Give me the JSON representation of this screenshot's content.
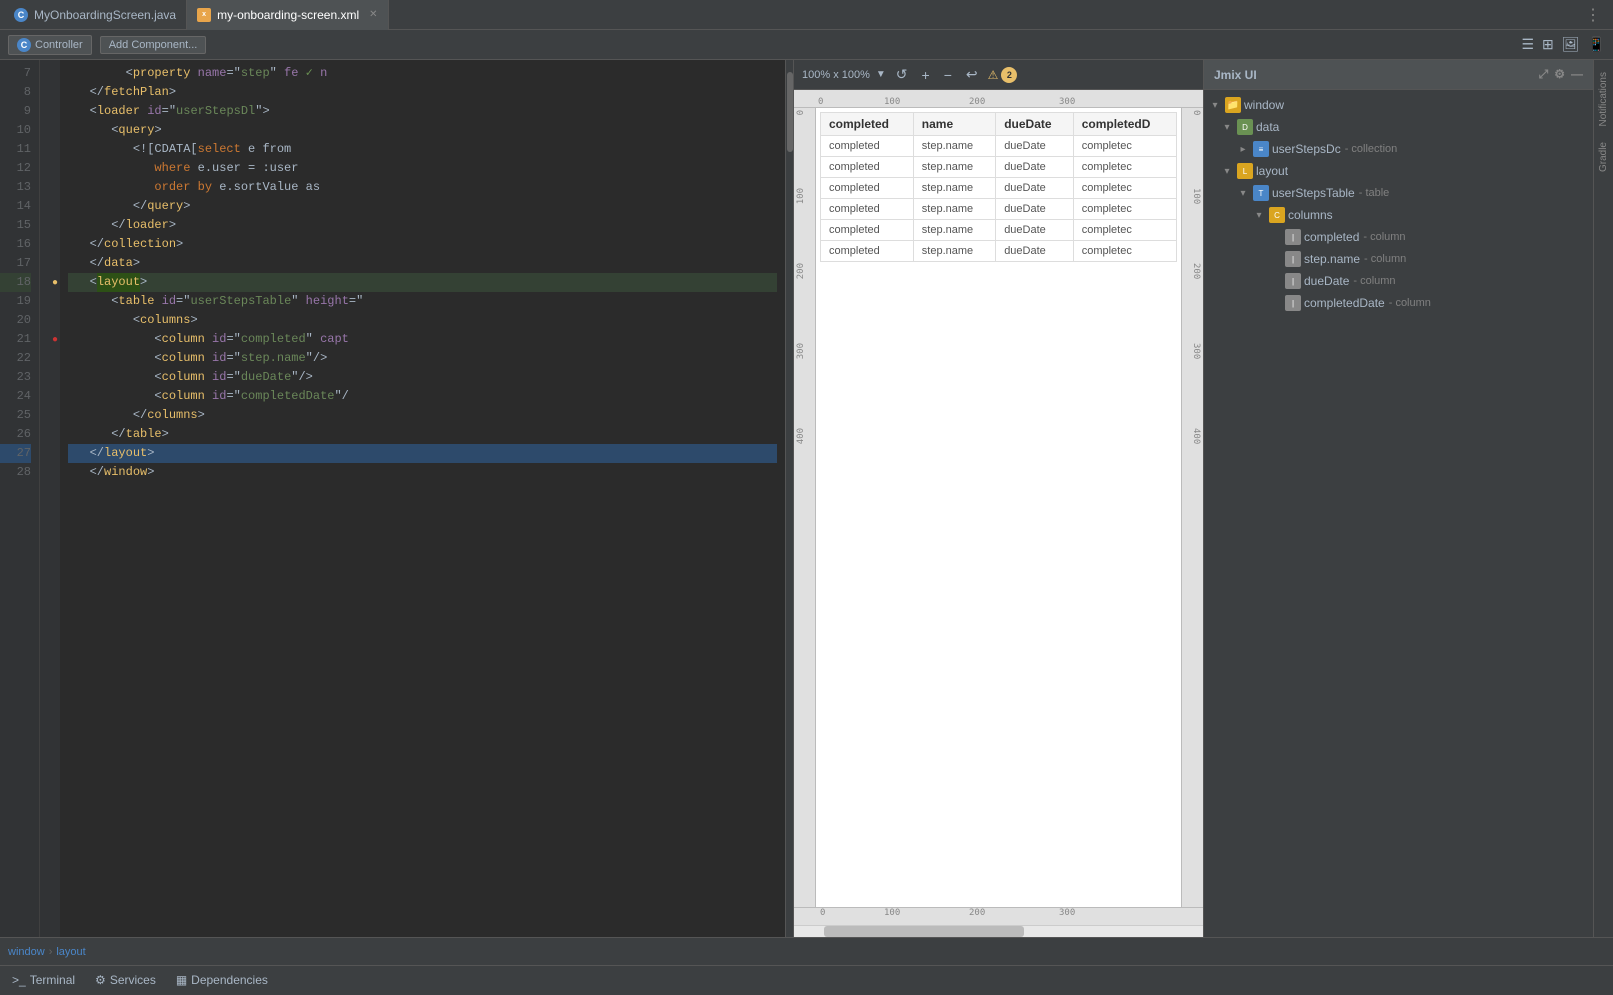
{
  "app": {
    "title": "Jmix UI"
  },
  "tabs": [
    {
      "id": "java",
      "label": "MyOnboardingScreen.java",
      "icon": "C",
      "active": false
    },
    {
      "id": "xml",
      "label": "my-onboarding-screen.xml",
      "icon": "xml",
      "active": true
    }
  ],
  "toolbar": {
    "controller_label": "Controller",
    "add_component_label": "Add Component..."
  },
  "editor": {
    "lines": [
      {
        "num": 7,
        "indent": 5,
        "content": "<property name=\"step\" fe ✓ n"
      },
      {
        "num": 8,
        "indent": 4,
        "content": "</fetchPlan>"
      },
      {
        "num": 9,
        "indent": 4,
        "content": "<loader id=\"userStepsDl\">"
      },
      {
        "num": 10,
        "indent": 5,
        "content": "<query>"
      },
      {
        "num": 11,
        "indent": 6,
        "content": "<![CDATA[select e from"
      },
      {
        "num": 12,
        "indent": 7,
        "content": "where e.user = :user"
      },
      {
        "num": 13,
        "indent": 7,
        "content": "order by e.sortValue as"
      },
      {
        "num": 14,
        "indent": 6,
        "content": "</query>"
      },
      {
        "num": 15,
        "indent": 5,
        "content": "</loader>"
      },
      {
        "num": 16,
        "indent": 4,
        "content": "</collection>"
      },
      {
        "num": 17,
        "indent": 3,
        "content": "</data>"
      },
      {
        "num": 18,
        "indent": 3,
        "content": "<layout>",
        "highlighted": true
      },
      {
        "num": 19,
        "indent": 4,
        "content": "<table id=\"userStepsTable\" height=\""
      },
      {
        "num": 20,
        "indent": 5,
        "content": "<columns>"
      },
      {
        "num": 21,
        "indent": 6,
        "content": "<column id=\"completed\" capt"
      },
      {
        "num": 22,
        "indent": 6,
        "content": "<column id=\"step.name\"/>"
      },
      {
        "num": 23,
        "indent": 6,
        "content": "<column id=\"dueDate\"/>"
      },
      {
        "num": 24,
        "indent": 6,
        "content": "<column id=\"completedDate\"/"
      },
      {
        "num": 25,
        "indent": 5,
        "content": "</columns>"
      },
      {
        "num": 26,
        "indent": 4,
        "content": "</table>"
      },
      {
        "num": 27,
        "indent": 3,
        "content": "</layout>",
        "selected": true
      },
      {
        "num": 28,
        "indent": 3,
        "content": "</window>"
      }
    ]
  },
  "preview": {
    "zoom": "100% x 100%",
    "table": {
      "headers": [
        "completed",
        "name",
        "dueDate",
        "completedD"
      ],
      "rows": [
        [
          "completed",
          "step.name",
          "dueDate",
          "completec"
        ],
        [
          "completed",
          "step.name",
          "dueDate",
          "completec"
        ],
        [
          "completed",
          "step.name",
          "dueDate",
          "completec"
        ],
        [
          "completed",
          "step.name",
          "dueDate",
          "completec"
        ],
        [
          "completed",
          "step.name",
          "dueDate",
          "completec"
        ],
        [
          "completed",
          "step.name",
          "dueDate",
          "completec"
        ]
      ]
    }
  },
  "jmix_tree": {
    "title": "Jmix UI",
    "items": [
      {
        "level": 0,
        "label": "window",
        "type": "",
        "icon": "folder",
        "expanded": true
      },
      {
        "level": 1,
        "label": "data",
        "type": "",
        "icon": "data",
        "expanded": true
      },
      {
        "level": 2,
        "label": "userStepsDc",
        "type": "- collection",
        "icon": "table",
        "expanded": false
      },
      {
        "level": 1,
        "label": "layout",
        "type": "",
        "icon": "folder",
        "expanded": true
      },
      {
        "level": 2,
        "label": "userStepsTable",
        "type": "- table",
        "icon": "table",
        "expanded": true
      },
      {
        "level": 3,
        "label": "columns",
        "type": "",
        "icon": "folder",
        "expanded": true
      },
      {
        "level": 4,
        "label": "completed",
        "type": "- column",
        "icon": "column",
        "expanded": false
      },
      {
        "level": 4,
        "label": "step.name",
        "type": "- column",
        "icon": "column",
        "expanded": false
      },
      {
        "level": 4,
        "label": "dueDate",
        "type": "- column",
        "icon": "column",
        "expanded": false
      },
      {
        "level": 4,
        "label": "completedDate",
        "type": "- column",
        "icon": "column",
        "expanded": false
      }
    ]
  },
  "breadcrumb": {
    "items": [
      "window",
      "layout"
    ]
  },
  "bottom_tabs": [
    {
      "label": "Terminal",
      "icon": ">_"
    },
    {
      "label": "Services",
      "icon": "⚙"
    },
    {
      "label": "Dependencies",
      "icon": "📦"
    }
  ],
  "gutter": {
    "line18_warning": "⚠",
    "line21_error": "🔴"
  },
  "warnings_count": 2
}
